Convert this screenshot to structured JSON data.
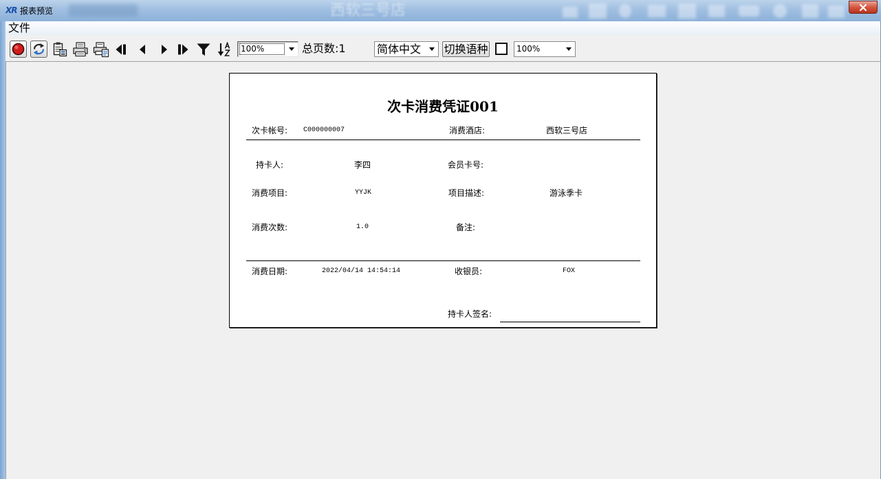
{
  "window": {
    "logo_text": "XR",
    "title": "报表预览",
    "glass_background_text": "西软三号店"
  },
  "menu": {
    "file_label": "文件"
  },
  "toolbar": {
    "icons": [
      "record-icon",
      "refresh-icon",
      "export-icon",
      "print-icon",
      "print-setup-icon",
      "first-page-icon",
      "prev-page-icon",
      "next-page-icon",
      "last-page-icon",
      "filter-icon",
      "sort-az-icon",
      "chevron-down-icon"
    ],
    "zoom": {
      "value": "100%"
    },
    "total_pages": "总页数:1",
    "language": {
      "value": "简体中文"
    },
    "switch_language_label": "切换语种",
    "checkbox_checked": false,
    "zoom2": {
      "value": "100%"
    }
  },
  "report": {
    "title": "次卡消费凭证001",
    "card_account": {
      "label": "次卡帐号:",
      "value": "C000000007"
    },
    "hotel": {
      "label": "消费酒店:",
      "value": "西软三号店"
    },
    "card_holder": {
      "label": "持卡人:",
      "value": "李四"
    },
    "member_card_no": {
      "label": "会员卡号:"
    },
    "item": {
      "label": "消费项目:",
      "value": "YYJK"
    },
    "item_desc": {
      "label": "项目描述:",
      "value": "游泳季卡"
    },
    "count": {
      "label": "消费次数:",
      "value": "1.0"
    },
    "remark": {
      "label": "备注:"
    },
    "date": {
      "label": "消费日期:",
      "value": "2022/04/14 14:54:14"
    },
    "cashier": {
      "label": "收银员:",
      "value": "FOX"
    },
    "signature": {
      "label": "持卡人签名:"
    }
  },
  "colors": {
    "titlebar": "#9dbde0",
    "close_button": "#c9463a",
    "record_dot": "#d31c1c",
    "workspace": "#f0f0f0",
    "paper": "#ffffff"
  }
}
